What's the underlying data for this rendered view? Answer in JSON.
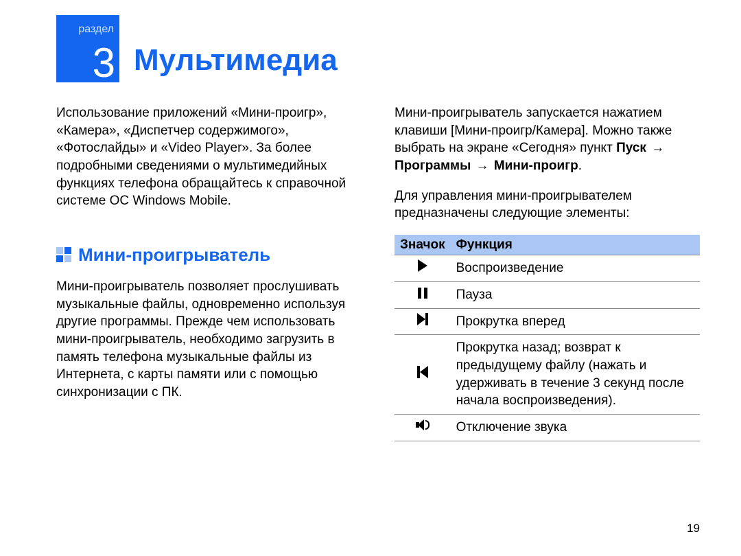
{
  "section": {
    "label": "раздел",
    "number": "3"
  },
  "chapter_title": "Мультимедиа",
  "intro_paragraph": "Использование приложений «Мини-проигр», «Камера», «Диспетчер содержимого», «Фотослайды» и «Video Player». За более подробными сведениями о мультимедийных функциях телефона обращайтесь к справочной системе ОС Windows Mobile.",
  "subsection_title": "Мини-проигрыватель",
  "subsection_paragraph": "Мини-проигрыватель позволяет прослушивать музыкальные файлы, одновременно используя другие программы. Прежде чем использовать мини-проигрыватель, необходимо загрузить в память телефона музыкальные файлы из Интернета, с карты памяти или с помощью синхронизации с ПК.",
  "right_intro_prefix": "Мини-проигрыватель запускается нажатием клавиши [Мини-проигр/Камера]. Можно также выбрать на экране «Сегодня» пункт ",
  "nav": {
    "start": "Пуск",
    "programs": "Программы",
    "mini": "Мини-проигр"
  },
  "nav_suffix": ".",
  "controls_intro": "Для управления мини-проигрывателем предназначены следующие элементы:",
  "table": {
    "header_icon": "Значок",
    "header_func": "Функция",
    "rows": [
      {
        "icon": "play",
        "func": "Воспроизведение"
      },
      {
        "icon": "pause",
        "func": "Пауза"
      },
      {
        "icon": "next",
        "func": "Прокрутка вперед"
      },
      {
        "icon": "prev",
        "func": "Прокрутка назад; возврат к предыдущему файлу (нажать и удерживать в течение 3 секунд после начала воспроизведения)."
      },
      {
        "icon": "mute",
        "func": "Отключение звука"
      }
    ]
  },
  "page_number": "19"
}
